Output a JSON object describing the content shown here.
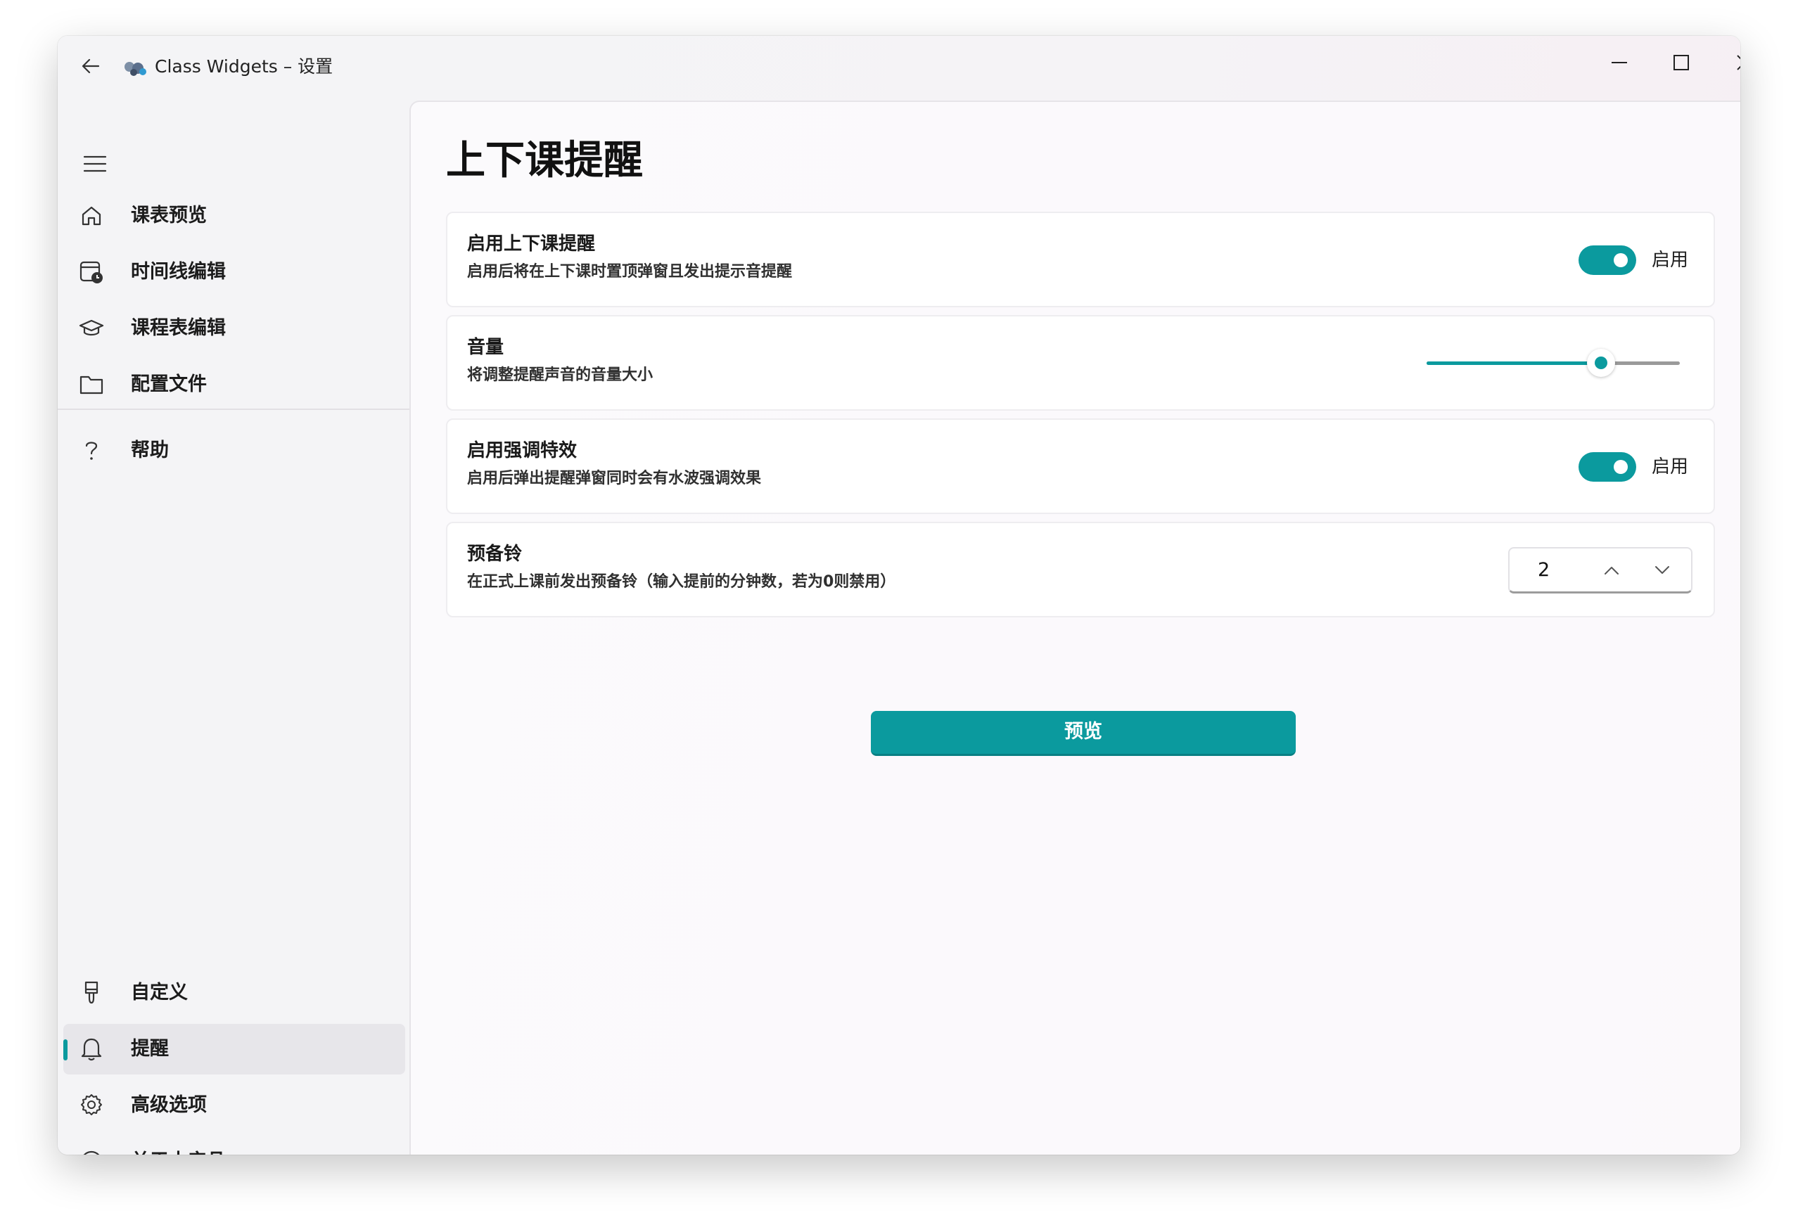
{
  "window": {
    "title": "Class Widgets – 设置"
  },
  "colors": {
    "accent": "#0b9a9e"
  },
  "sidebar": {
    "top_items": [
      {
        "label": "课表预览",
        "icon": "home-icon"
      },
      {
        "label": "时间线编辑",
        "icon": "calendar-clock-icon"
      },
      {
        "label": "课程表编辑",
        "icon": "graduation-cap-icon"
      },
      {
        "label": "配置文件",
        "icon": "folder-icon"
      },
      {
        "label": "帮助",
        "icon": "question-icon"
      }
    ],
    "bottom_items": [
      {
        "label": "自定义",
        "icon": "brush-icon"
      },
      {
        "label": "提醒",
        "icon": "bell-icon",
        "active": true
      },
      {
        "label": "高级选项",
        "icon": "gear-icon"
      },
      {
        "label": "关于本产品",
        "icon": "info-icon"
      }
    ]
  },
  "main": {
    "title": "上下课提醒",
    "cards": [
      {
        "title": "启用上下课提醒",
        "desc": "启用后将在上下课时置顶弹窗且发出提示音提醒",
        "control": "toggle",
        "state": true,
        "state_label": "启用"
      },
      {
        "title": "音量",
        "desc": "将调整提醒声音的音量大小",
        "control": "slider",
        "value": 0.69
      },
      {
        "title": "启用强调特效",
        "desc": "启用后弹出提醒弹窗同时会有水波强调效果",
        "control": "toggle",
        "state": true,
        "state_label": "启用"
      },
      {
        "title": "预备铃",
        "desc": "在正式上课前发出预备铃（输入提前的分钟数，若为0则禁用）",
        "control": "spinbox",
        "value": "2"
      }
    ],
    "preview_button": "预览"
  }
}
